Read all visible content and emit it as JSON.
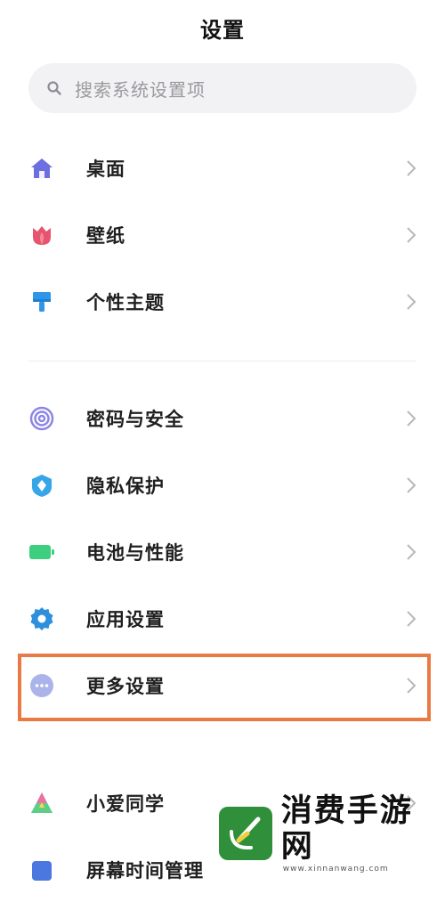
{
  "header": {
    "title": "设置"
  },
  "search": {
    "placeholder": "搜索系统设置项",
    "icon": "search-icon"
  },
  "group1": [
    {
      "label": "桌面",
      "icon": "home-icon",
      "color": "#6b6fe0"
    },
    {
      "label": "壁纸",
      "icon": "tulip-icon",
      "color": "#e8536e"
    },
    {
      "label": "个性主题",
      "icon": "paintbrush-icon",
      "color": "#2f95e8"
    }
  ],
  "group2": [
    {
      "label": "密码与安全",
      "icon": "fingerprint-icon",
      "color": "#8b86e6"
    },
    {
      "label": "隐私保护",
      "icon": "shield-icon",
      "color": "#36a6e8"
    },
    {
      "label": "电池与性能",
      "icon": "battery-icon",
      "color": "#3ecf7e"
    },
    {
      "label": "应用设置",
      "icon": "gear-icon",
      "color": "#2e8fdc"
    },
    {
      "label": "更多设置",
      "icon": "more-dots-icon",
      "color": "#aab4ea",
      "highlighted": true
    }
  ],
  "group3": [
    {
      "label": "小爱同学",
      "icon": "xiaoai-icon"
    },
    {
      "label": "屏幕时间管理",
      "icon": "screen-time-icon",
      "color": "#4a77e0"
    }
  ],
  "highlight_color": "#ea7a45",
  "watermark": {
    "title": "消费手游网",
    "url": "www.xinnanwang.com",
    "logo_color": "#2f8f3a"
  }
}
